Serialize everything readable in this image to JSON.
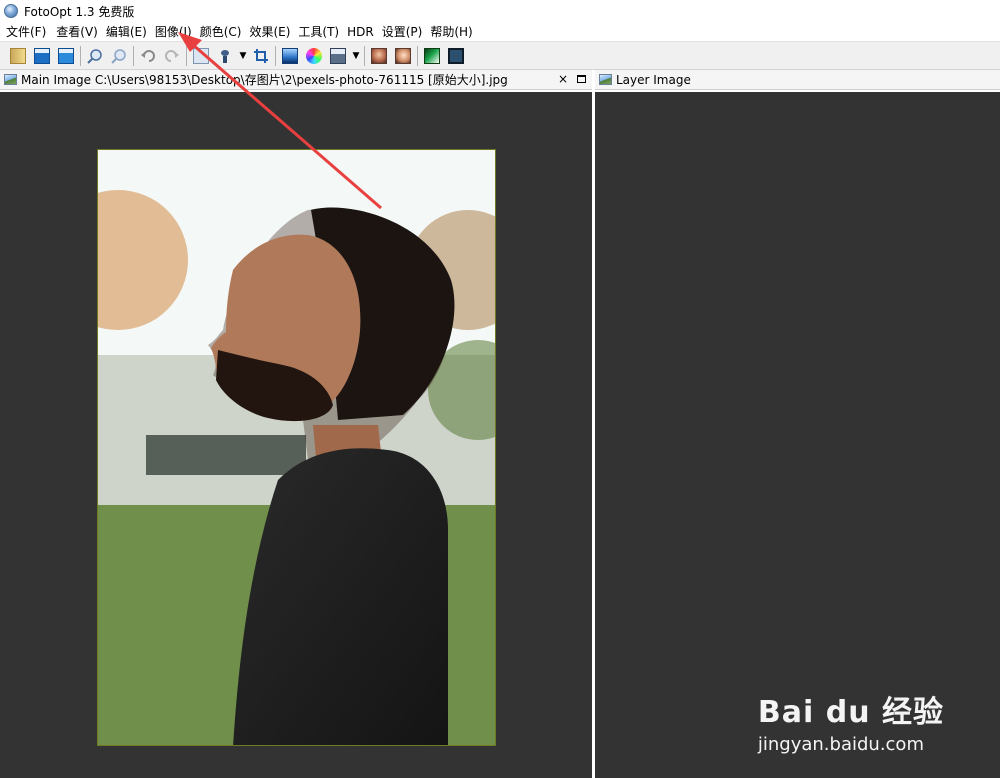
{
  "window": {
    "title": "FotoOpt 1.3 免费版"
  },
  "menu": [
    "文件(F)",
    "查看(V)",
    "编辑(E)",
    "图像(I)",
    "颜色(C)",
    "效果(E)",
    "工具(T)",
    "HDR",
    "设置(P)",
    "帮助(H)"
  ],
  "toolbar": {
    "buttons": [
      "open-icon",
      "save-icon",
      "save-as-icon",
      "zoom-in-icon",
      "zoom-out-icon",
      "undo-icon",
      "redo-icon",
      "resize-icon",
      "brush-icon",
      "crop-icon",
      "levels-icon",
      "color-wheel-icon",
      "filmstrip-icon",
      "portrait-icon",
      "face-icon",
      "gradient-icon",
      "film-icon"
    ]
  },
  "main_panel": {
    "title": "Main Image C:\\Users\\98153\\Desktop\\存图片\\2\\pexels-photo-761115 [原始大小].jpg",
    "close": "×"
  },
  "layer_panel": {
    "title": "Layer Image"
  },
  "watermark": {
    "brand": "Bai du 经验",
    "url": "jingyan.baidu.com"
  },
  "colors": {
    "canvas": "#333333",
    "arrow": "#e8403f"
  }
}
